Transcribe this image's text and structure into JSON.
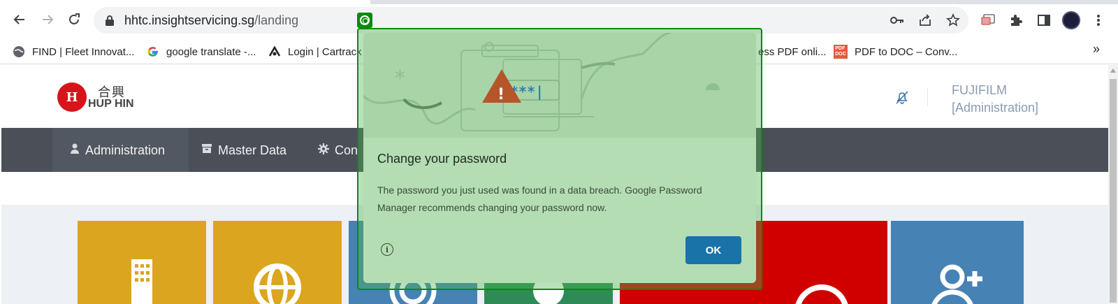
{
  "browser": {
    "url_host": "hhtc.insightservicing.sg",
    "url_path": "/landing",
    "icons": [
      "back-arrow-icon",
      "forward-arrow-icon",
      "reload-icon",
      "lock-icon",
      "key-icon",
      "share-icon",
      "star-icon",
      "cast-icon",
      "extensions-icon",
      "side-panel-icon",
      "avatar",
      "more-vert-icon"
    ]
  },
  "bookmarks": [
    {
      "label": "FIND | Fleet Innovat...",
      "icon": "globe-icon"
    },
    {
      "label": "google translate -...",
      "icon": "google-icon"
    },
    {
      "label": "Login | Cartrack",
      "icon": "cartrack-icon"
    },
    {
      "label": "ess PDF onli...",
      "icon": "pdf-icon"
    },
    {
      "label": "PDF to DOC – Conv...",
      "icon": "pdf-doc-icon"
    }
  ],
  "bookmarks_more": "»",
  "site": {
    "logo_mark": "H",
    "logo_cn": "合興",
    "logo_en": "HUP HIN",
    "user_line1": "FUJIFILM",
    "user_line2": "[Administration]"
  },
  "nav": [
    {
      "label": "Administration",
      "icon": "user-icon"
    },
    {
      "label": "Master Data",
      "icon": "archive-icon"
    },
    {
      "label": "Con",
      "icon": "gear-icon"
    }
  ],
  "tiles": [
    {
      "color": "#dba520",
      "icon": "building-icon"
    },
    {
      "color": "#dba520",
      "icon": "globe-icon"
    },
    {
      "color": "#4682b4",
      "icon": "target-icon"
    },
    {
      "color": "#2e8b57",
      "icon": "gear-icon"
    },
    {
      "color": "#d10000",
      "icon": "user-icon"
    },
    {
      "color": "#d10000",
      "icon": "user-icon"
    },
    {
      "color": "#4682b4",
      "icon": "user-plus-icon"
    }
  ],
  "dialog": {
    "title": "Change your password",
    "body": "The password you just used was found in a data breach. Google Password Manager recommends changing your password now.",
    "ok_label": "OK",
    "hero_password": "***|",
    "hero_warning": "!"
  }
}
